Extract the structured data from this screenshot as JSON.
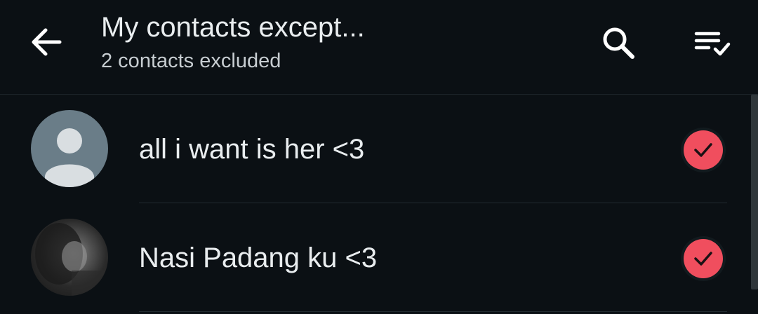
{
  "header": {
    "title": "My contacts except...",
    "subtitle": "2 contacts excluded",
    "back_icon": "arrow-left-icon",
    "search_icon": "search-icon",
    "select_all_icon": "select-all-checklist-icon"
  },
  "contacts": [
    {
      "name": "all i want is her <3",
      "avatar": "default-person-icon",
      "selected": true
    },
    {
      "name": "Nasi Padang ku <3",
      "avatar": "profile-photo",
      "selected": true
    }
  ],
  "colors": {
    "background": "#0b1014",
    "text": "#e9edef",
    "check_accent": "#f04e5e",
    "default_avatar": "#6a7d88"
  }
}
